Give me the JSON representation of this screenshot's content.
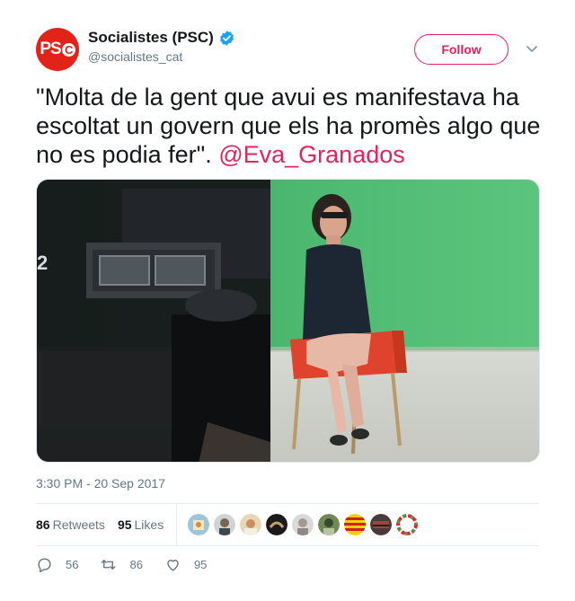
{
  "header": {
    "avatar_text": "PS",
    "avatar_c": "C",
    "display_name": "Socialistes (PSC)",
    "handle": "@socialistes_cat",
    "follow_label": "Follow"
  },
  "tweet": {
    "text": "\"Molta de la gent que avui es manifestava ha escoltat un govern que els ha promès algo que no es podia fer\". ",
    "mention": "@Eva_Granados",
    "media_overlay": "2",
    "timestamp": "3:30 PM - 20 Sep 2017"
  },
  "stats": {
    "retweets_count": "86",
    "retweets_label": "Retweets",
    "likes_count": "95",
    "likes_label": "Likes"
  },
  "actions": {
    "replies": "56",
    "retweets": "86",
    "likes": "95"
  },
  "colors": {
    "brand_red": "#e2231a",
    "accent": "#e0245e",
    "verified": "#1da1f2",
    "muted": "#657786"
  }
}
